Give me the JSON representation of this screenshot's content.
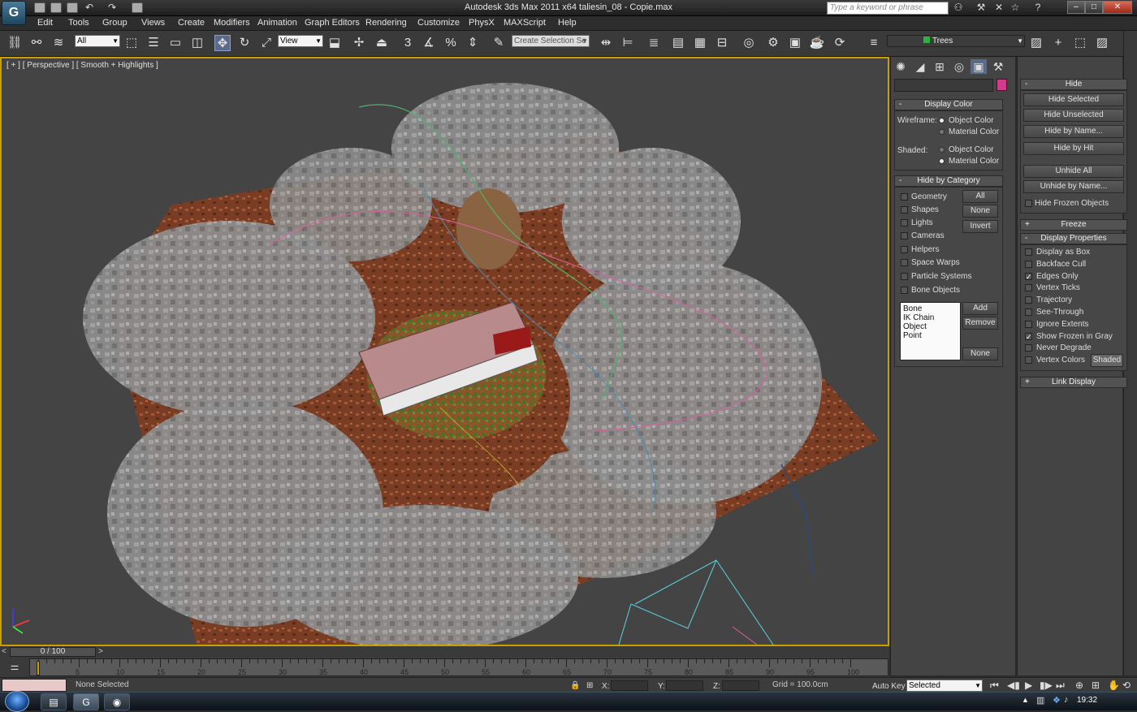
{
  "window": {
    "title": "Autodesk 3ds Max  2011 x64      taliesin_08 - Copie.max",
    "search_placeholder": "Type a keyword or phrase",
    "app_logo": "G"
  },
  "menu": [
    "Edit",
    "Tools",
    "Group",
    "Views",
    "Create",
    "Modifiers",
    "Animation",
    "Graph Editors",
    "Rendering",
    "Customize",
    "PhysX",
    "MAXScript",
    "Help"
  ],
  "toolbar": {
    "selection_filter": "All",
    "ref_coord": "View",
    "named_selection": "Create Selection Se",
    "snap_value": "3",
    "layer_name": "Trees"
  },
  "viewport": {
    "label": "[ + ] [ Perspective ] [ Smooth + Highlights ]"
  },
  "display_color": {
    "title": "Display Color",
    "wireframe_label": "Wireframe:",
    "shaded_label": "Shaded:",
    "object_color": "Object Color",
    "material_color": "Material Color"
  },
  "hide_by_category": {
    "title": "Hide by Category",
    "items": [
      "Geometry",
      "Shapes",
      "Lights",
      "Cameras",
      "Helpers",
      "Space Warps",
      "Particle Systems",
      "Bone Objects"
    ],
    "buttons": [
      "All",
      "None",
      "Invert"
    ],
    "list": [
      "Bone",
      "IK Chain Object",
      "Point"
    ],
    "add": "Add",
    "remove": "Remove",
    "none": "None"
  },
  "hide": {
    "title": "Hide",
    "buttons": [
      "Hide Selected",
      "Hide Unselected",
      "Hide by Name...",
      "Hide by Hit"
    ],
    "unhide_all": "Unhide All",
    "unhide_by_name": "Unhide by Name...",
    "hide_frozen": "Hide Frozen Objects"
  },
  "freeze": {
    "title": "Freeze"
  },
  "display_properties": {
    "title": "Display Properties",
    "items": [
      {
        "label": "Display as Box",
        "checked": false
      },
      {
        "label": "Backface Cull",
        "checked": false
      },
      {
        "label": "Edges Only",
        "checked": true
      },
      {
        "label": "Vertex Ticks",
        "checked": false
      },
      {
        "label": "Trajectory",
        "checked": false
      },
      {
        "label": "See-Through",
        "checked": false
      },
      {
        "label": "Ignore Extents",
        "checked": false
      },
      {
        "label": "Show Frozen in Gray",
        "checked": true
      },
      {
        "label": "Never Degrade",
        "checked": false
      },
      {
        "label": "Vertex Colors",
        "checked": false
      }
    ],
    "shaded_btn": "Shaded"
  },
  "link_display": {
    "title": "Link Display"
  },
  "timeline": {
    "frame": "0 / 100",
    "ticks": [
      "5",
      "10",
      "15",
      "20",
      "25",
      "30",
      "35",
      "40",
      "45",
      "50",
      "55",
      "60",
      "65",
      "70",
      "75",
      "80",
      "85",
      "90",
      "95",
      "100"
    ]
  },
  "status": {
    "selection": "None Selected",
    "x_label": "X:",
    "y_label": "Y:",
    "z_label": "Z:",
    "grid": "Grid = 100.0cm",
    "auto_key": "Auto Key",
    "key_mode": "Selected"
  },
  "taskbar": {
    "clock": "19:32"
  },
  "colors": {
    "viewport_border": "#c8a000",
    "accent": "#d23c8c"
  }
}
